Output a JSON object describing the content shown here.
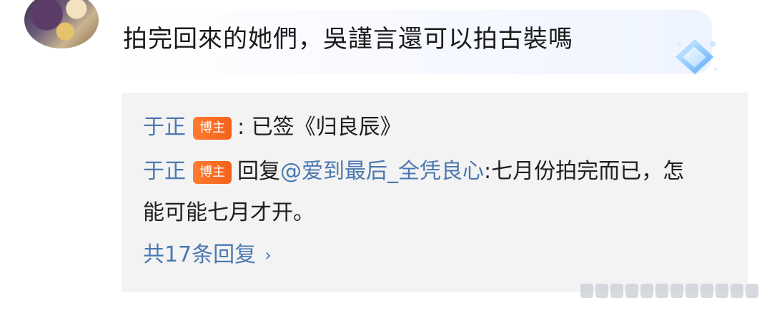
{
  "comment": {
    "text": "拍完回來的她們，吳謹言還可以拍古裝嗎",
    "avatar_icon": "avatar-image",
    "badge_icon": "diamond-badge-icon"
  },
  "replies": [
    {
      "user": "于正",
      "tag": "博主",
      "prefix": "",
      "mention": "",
      "text": ": 已签《归良辰》"
    },
    {
      "user": "于正",
      "tag": "博主",
      "prefix": "回复",
      "mention": "@爱到最后_全凭良心",
      "text": ":七月份拍完而已，怎能可能七月才开。"
    }
  ],
  "more_replies": {
    "label": "共17条回复",
    "chevron": "›"
  },
  "colors": {
    "link": "#4b78b0",
    "tag_bg": "#f3621a",
    "panel_bg": "#f3f3f3"
  }
}
